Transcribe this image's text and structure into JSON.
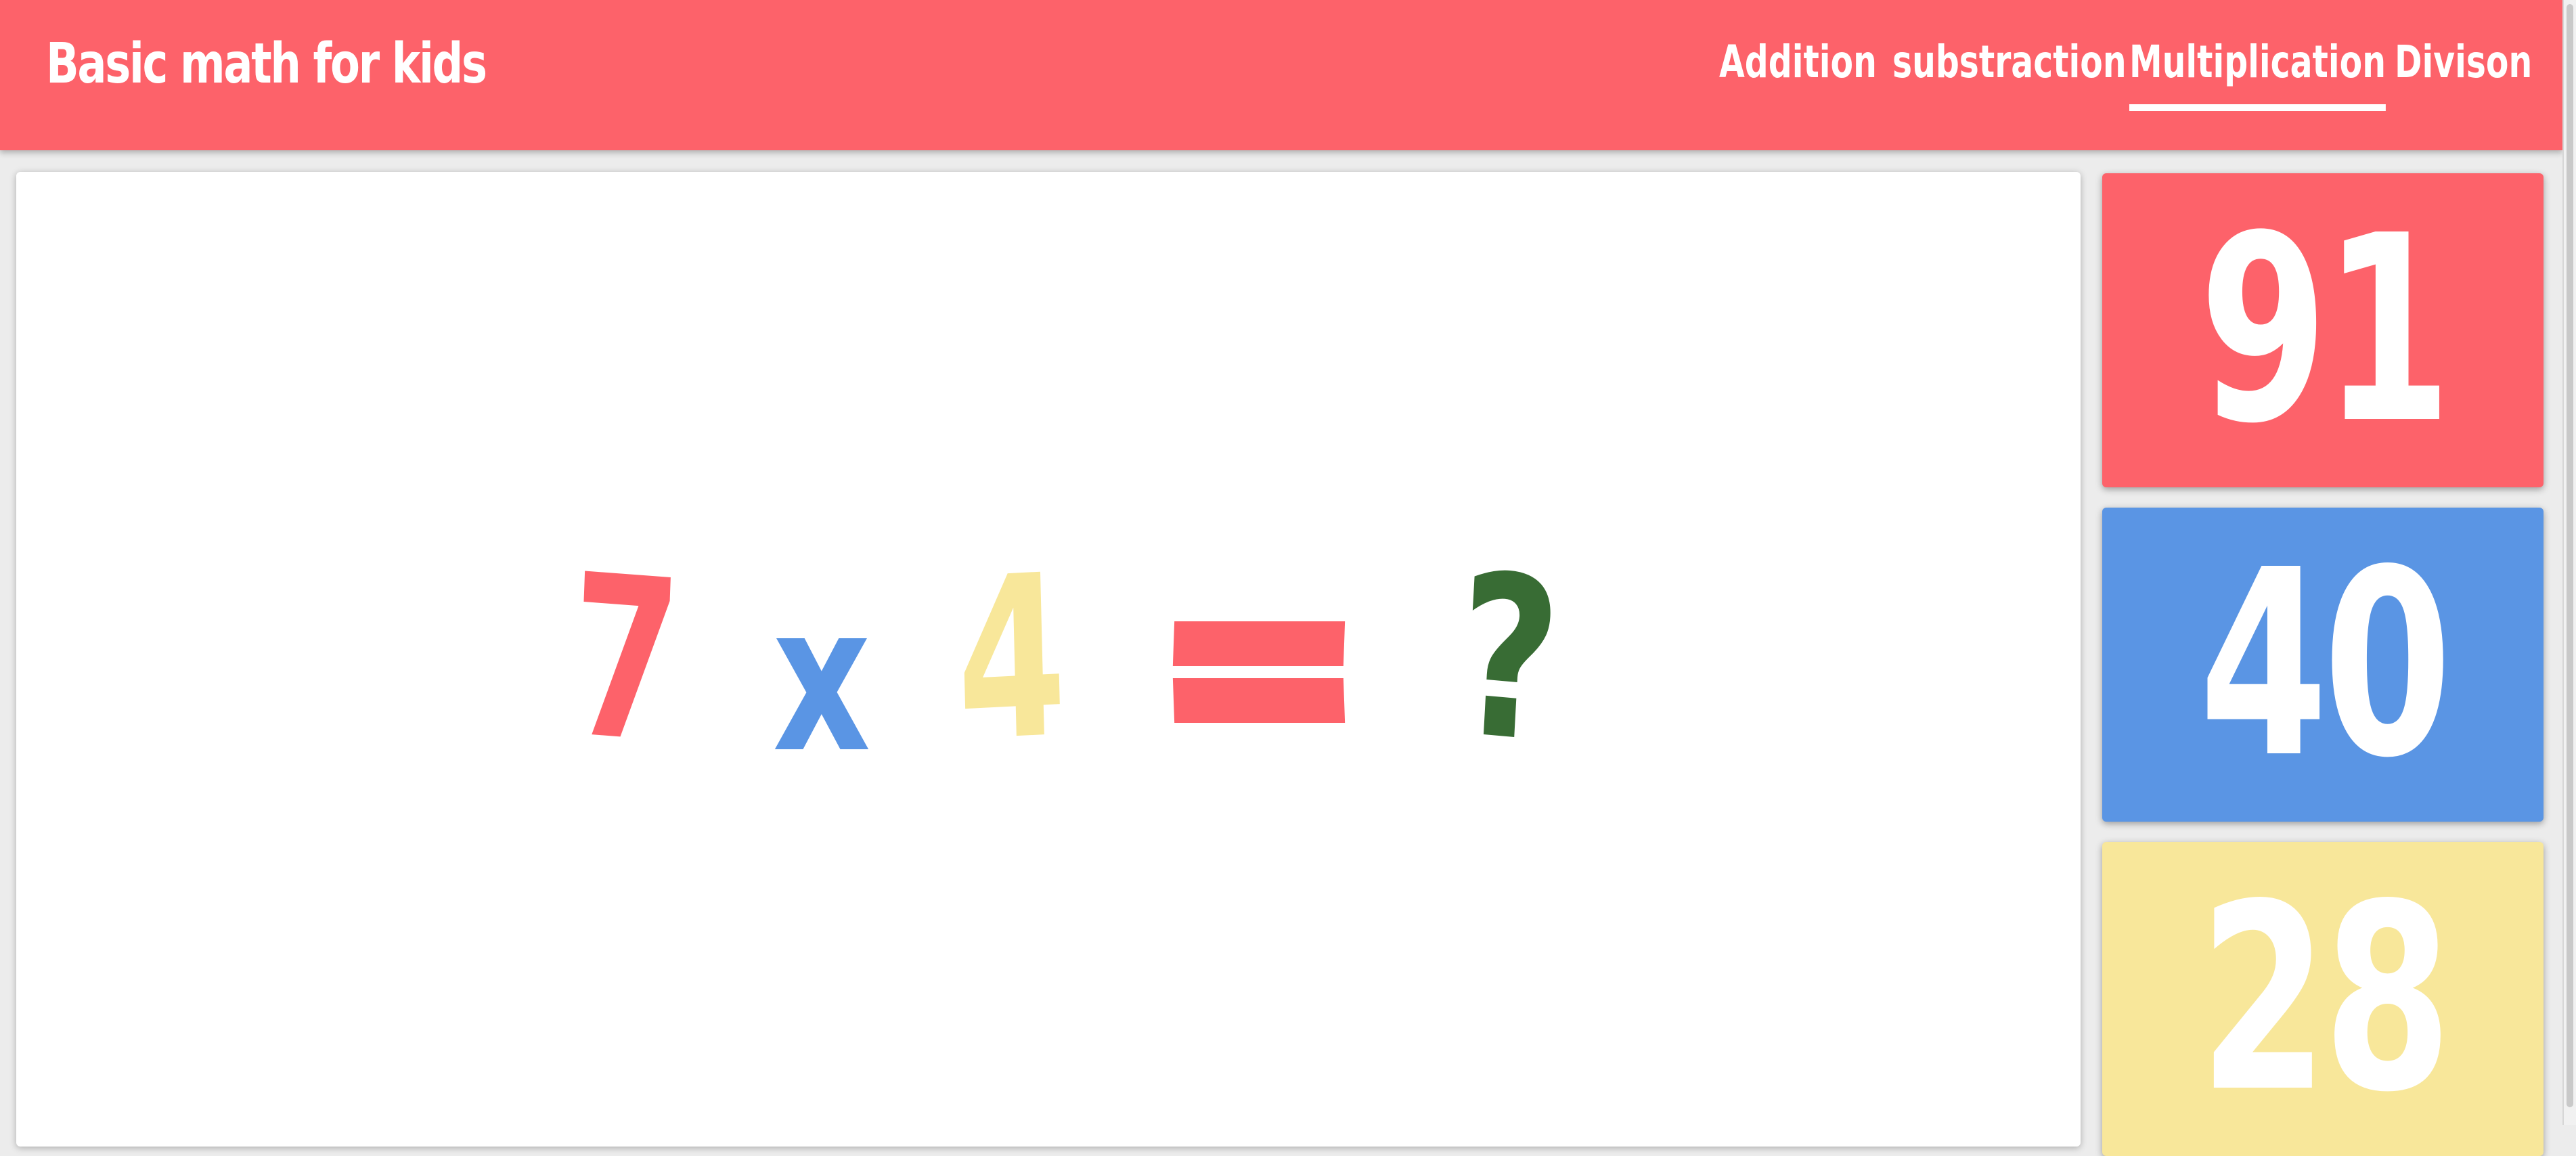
{
  "header": {
    "title": "Basic math for kids",
    "background_color": "#fd626a",
    "nav": [
      {
        "label": "Addition",
        "active": false
      },
      {
        "label": "substraction",
        "active": false
      },
      {
        "label": "Multiplication",
        "active": true
      },
      {
        "label": "Divison",
        "active": false
      }
    ]
  },
  "problem": {
    "operand_a": "7",
    "operator": "x",
    "operand_b": "4",
    "unknown": "?",
    "colors": {
      "operand_a": "#fd626a",
      "operator": "#5a95e4",
      "operand_b": "#f8e79a",
      "equals": "#fd626a",
      "unknown": "#386c34"
    }
  },
  "answers": [
    {
      "value": "91",
      "color": "#fd626a"
    },
    {
      "value": "40",
      "color": "#5a95e4"
    },
    {
      "value": "28",
      "color": "#f8e79a"
    }
  ]
}
